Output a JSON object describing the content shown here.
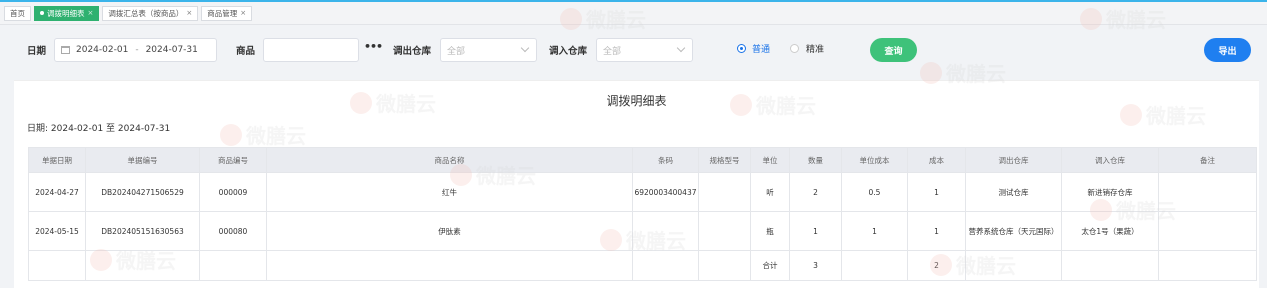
{
  "tabs": [
    {
      "label": "首页",
      "active": false,
      "closable": false
    },
    {
      "label": "调拨明细表",
      "active": true,
      "closable": true
    },
    {
      "label": "调拨汇总表（按商品）",
      "active": false,
      "closable": true
    },
    {
      "label": "商品管理",
      "active": false,
      "closable": true
    }
  ],
  "filter": {
    "date_label": "日期",
    "date_start": "2024-02-01",
    "date_sep": "-",
    "date_end": "2024-07-31",
    "product_label": "商品",
    "product_value": "",
    "more_glyph": "•••",
    "out_wh_label": "调出仓库",
    "out_wh_placeholder": "全部",
    "in_wh_label": "调入仓库",
    "in_wh_placeholder": "全部",
    "mode_normal": "普通",
    "mode_exact": "精准",
    "mode_selected": "普通",
    "query_button": "查询",
    "export_button": "导出"
  },
  "report": {
    "title": "调拨明细表",
    "date_range": "日期: 2024-02-01 至 2024-07-31",
    "columns": [
      "单据日期",
      "单据编号",
      "商品编号",
      "商品名称",
      "条码",
      "规格型号",
      "单位",
      "数量",
      "单位成本",
      "成本",
      "调出仓库",
      "调入仓库",
      "备注"
    ],
    "rows": [
      [
        "2024-04-27",
        "DB202404271506529",
        "000009",
        "红牛",
        "6920003400437",
        "",
        "听",
        "2",
        "0.5",
        "1",
        "测试仓库",
        "新进销存仓库",
        ""
      ],
      [
        "2024-05-15",
        "DB202405151630563",
        "000080",
        "伊肽素",
        "",
        "",
        "瓶",
        "1",
        "1",
        "1",
        "营养系统仓库（天元国际）",
        "太仓1号（果蔬）",
        ""
      ]
    ],
    "total": [
      "",
      "",
      "",
      "",
      "",
      "",
      "合计",
      "3",
      "",
      "2",
      "",
      "",
      ""
    ]
  },
  "watermark": "微膳云",
  "colors": {
    "accent_green": "#2fb170",
    "query_green": "#3ec27a",
    "export_blue": "#1f7ff0",
    "radio_blue": "#1a73e8"
  }
}
